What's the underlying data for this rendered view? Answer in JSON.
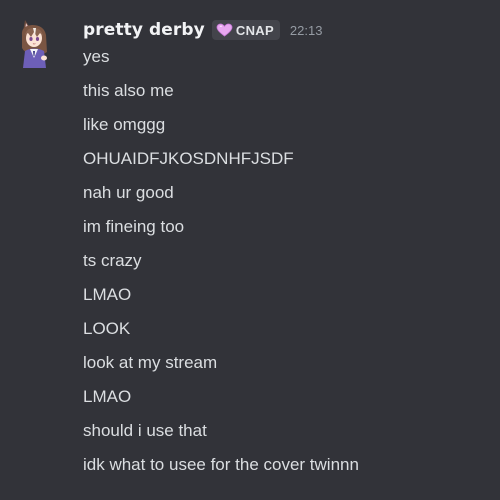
{
  "author": {
    "name": "pretty derby",
    "tag": "CNAP",
    "tag_icon": "heart-icon",
    "timestamp": "22:13",
    "avatar_icon": "anime-avatar-icon"
  },
  "messages": [
    "yes",
    "this also me",
    "like omggg",
    "OHUAIDFJKOSDNHFJSDF",
    "nah ur good",
    "im fineing too",
    "ts crazy",
    "LMAO",
    "LOOK",
    "look at my stream",
    "LMAO",
    "should i use that",
    "idk what to usee for the cover twinnn"
  ],
  "colors": {
    "background": "#323339",
    "username": "#f2f3f5",
    "message_text": "#dbdee1",
    "timestamp": "#959ba3",
    "tag_background": "#43444b",
    "tag_heart": "#e8a7f0"
  }
}
